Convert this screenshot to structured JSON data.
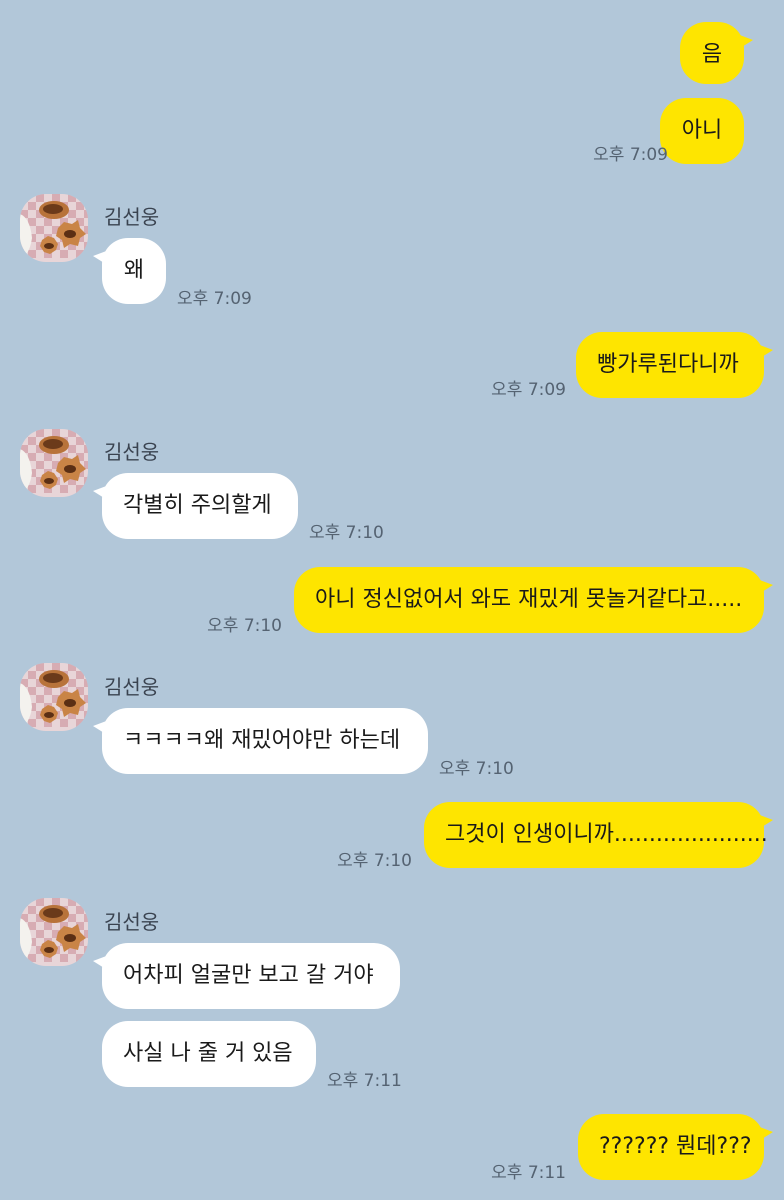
{
  "sender_name": "김선웅",
  "messages": [
    {
      "from": "me",
      "text": "음"
    },
    {
      "from": "me",
      "text": "아니",
      "time": "오후 7:09"
    },
    {
      "from": "them",
      "text": "왜",
      "time": "오후 7:09"
    },
    {
      "from": "me",
      "text": "빵가루된다니까",
      "time": "오후 7:09"
    },
    {
      "from": "them",
      "text": "각별히 주의할게",
      "time": "오후 7:10"
    },
    {
      "from": "me",
      "text": "아니 정신없어서 와도 재밌게 못놀거같다고.....",
      "time": "오후 7:10"
    },
    {
      "from": "them",
      "text": "ㅋㅋㅋㅋ왜 재밌어야만 하는데",
      "time": "오후 7:10"
    },
    {
      "from": "me",
      "text": "그것이 인생이니까......................",
      "time": "오후 7:10"
    },
    {
      "from": "them",
      "text": "어차피 얼굴만 보고 갈 거야"
    },
    {
      "from": "them",
      "text": "사실 나 줄 거 있음",
      "time": "오후 7:11"
    },
    {
      "from": "me",
      "text": "?????? 뭔데???",
      "time": "오후 7:11"
    }
  ],
  "colors": {
    "background": "#b2c7d9",
    "my_bubble": "#fee500",
    "their_bubble": "#ffffff",
    "timestamp": "#556372"
  },
  "icons": {
    "avatar": "cookie-profile-photo"
  }
}
